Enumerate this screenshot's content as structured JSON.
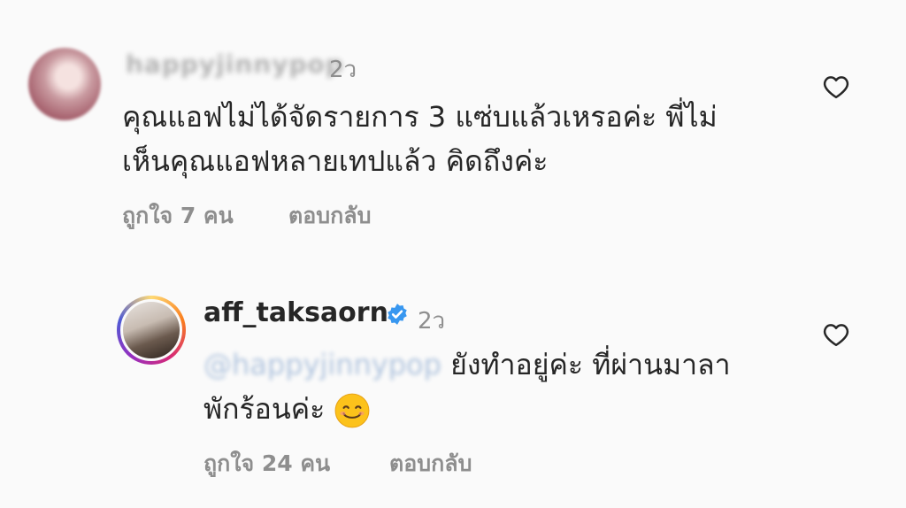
{
  "comments": [
    {
      "username": "happyjinnypop",
      "time": "2ว",
      "text_line1": "คุณแอฟไม่ได้จัดรายการ 3 แซ่บแล้วเหรอค่ะ พี่ไม่",
      "text_line2": "เห็นคุณแอฟหลายเทปแล้ว  คิดถึงค่ะ",
      "likes": "ถูกใจ 7 คน",
      "reply_label": "ตอบกลับ"
    },
    {
      "username": "aff_taksaorn",
      "verified": true,
      "time": "2ว",
      "mention": "@happyjinnypop",
      "text_line1": " ยังทำอยู่ค่ะ ที่ผ่านมาลา",
      "text_line2": "พักร้อนค่ะ",
      "emoji": "smiling-face",
      "likes": "ถูกใจ 24 คน",
      "reply_label": "ตอบกลับ"
    }
  ],
  "colors": {
    "background": "#fafafa",
    "text": "#262626",
    "secondary": "#8e8e8e",
    "verified": "#3897f0",
    "mention": "#b0c4de"
  },
  "icons": [
    "heart-outline-icon",
    "verified-badge-icon",
    "smiling-face-emoji"
  ]
}
